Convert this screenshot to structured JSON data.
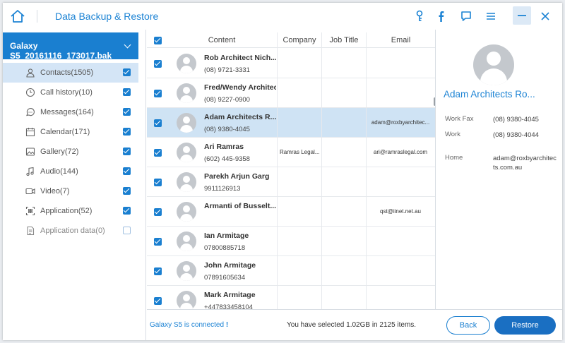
{
  "app": {
    "title": "Data Backup & Restore"
  },
  "titlebar_icons": [
    "home-icon",
    "key-icon",
    "facebook-icon",
    "feedback-icon",
    "menu-icon",
    "minimize-icon",
    "close-icon"
  ],
  "sidebar": {
    "device": "Galaxy S5_20161116_173017.bak",
    "categories": [
      {
        "label": "Contacts(1505)",
        "icon": "contacts-icon",
        "checked": true,
        "active": true
      },
      {
        "label": "Call history(10)",
        "icon": "clock-icon",
        "checked": true
      },
      {
        "label": "Messages(164)",
        "icon": "message-icon",
        "checked": true
      },
      {
        "label": "Calendar(171)",
        "icon": "calendar-icon",
        "checked": true
      },
      {
        "label": "Gallery(72)",
        "icon": "image-icon",
        "checked": true
      },
      {
        "label": "Audio(144)",
        "icon": "music-icon",
        "checked": true
      },
      {
        "label": "Video(7)",
        "icon": "video-icon",
        "checked": true
      },
      {
        "label": "Application(52)",
        "icon": "apps-icon",
        "checked": true
      },
      {
        "label": "Application data(0)",
        "icon": "document-icon",
        "checked": false
      }
    ]
  },
  "table": {
    "headers": {
      "content": "Content",
      "company": "Company",
      "job_title": "Job Title",
      "email": "Email"
    },
    "rows": [
      {
        "name": "Rob Architect Nich...",
        "phone": "(08) 9721-3331",
        "company": "",
        "email": "",
        "checked": true
      },
      {
        "name": "Fred/Wendy Architect...",
        "phone": "(08) 9227-0900",
        "company": "",
        "email": "",
        "checked": true
      },
      {
        "name": "Adam Architects R...",
        "phone": "(08) 9380-4045",
        "company": "",
        "email": "adam@roxbyarchitec...",
        "checked": true,
        "selected": true
      },
      {
        "name": "Ari Ramras",
        "phone": "(602) 445-9358",
        "company": "Ramras Legal...",
        "email": "ari@ramraslegal.com",
        "checked": true
      },
      {
        "name": "Parekh Arjun Garg",
        "phone": "9911126913",
        "company": "",
        "email": "",
        "checked": true
      },
      {
        "name": "Armanti of Busselt...",
        "phone": "",
        "company": "",
        "email": "qst@iinet.net.au",
        "checked": true
      },
      {
        "name": "Ian Armitage",
        "phone": "07800885718",
        "company": "",
        "email": "",
        "checked": true
      },
      {
        "name": "John Armitage",
        "phone": "07891605634",
        "company": "",
        "email": "",
        "checked": true
      },
      {
        "name": "Mark Armitage",
        "phone": "+447833458104",
        "company": "",
        "email": "",
        "checked": true
      }
    ]
  },
  "detail": {
    "name": "Adam Architects Ro...",
    "fields": [
      {
        "label": "Work Fax",
        "value": "(08) 9380-4045"
      },
      {
        "label": "Work",
        "value": "(08) 9380-4044"
      },
      {
        "label": "Home",
        "value": "adam@roxbyarchitects.com.au"
      }
    ]
  },
  "footer": {
    "status": "Galaxy S5 is connected",
    "status_mark": "!",
    "selection": "You have selected 1.02GB in 2125 items.",
    "back_label": "Back",
    "restore_label": "Restore"
  },
  "colors": {
    "accent": "#1a7fd0",
    "selected_row": "#cfe3f4",
    "active_category": "#d4e5f6",
    "restore_button": "#1a6fc2"
  }
}
